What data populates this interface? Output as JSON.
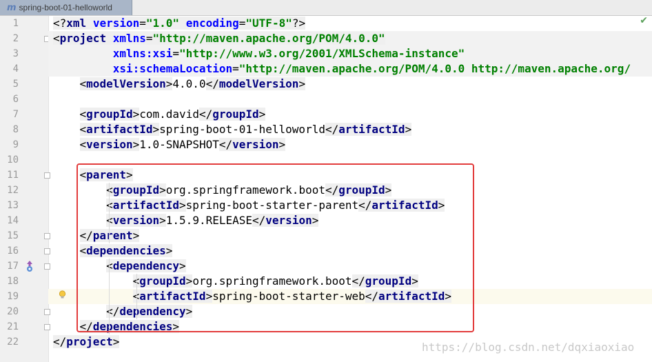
{
  "tab": {
    "icon": "maven-icon",
    "icon_glyph": "m",
    "label": "spring-boot-01-helloworld"
  },
  "status": {
    "check_icon": "checkmark-icon"
  },
  "watermark": "https://blog.csdn.net/dqxiaoxiao",
  "lines": [
    {
      "n": "1",
      "code": "<?xml version=\"1.0\" encoding=\"UTF-8\"?>"
    },
    {
      "n": "2",
      "code": "<project xmlns=\"http://maven.apache.org/POM/4.0.0\""
    },
    {
      "n": "3",
      "code": "         xmlns:xsi=\"http://www.w3.org/2001/XMLSchema-instance\""
    },
    {
      "n": "4",
      "code": "         xsi:schemaLocation=\"http://maven.apache.org/POM/4.0.0 http://maven.apache.org/"
    },
    {
      "n": "5",
      "code": "    <modelVersion>4.0.0</modelVersion>"
    },
    {
      "n": "6",
      "code": ""
    },
    {
      "n": "7",
      "code": "    <groupId>com.david</groupId>"
    },
    {
      "n": "8",
      "code": "    <artifactId>spring-boot-01-helloworld</artifactId>"
    },
    {
      "n": "9",
      "code": "    <version>1.0-SNAPSHOT</version>"
    },
    {
      "n": "10",
      "code": ""
    },
    {
      "n": "11",
      "code": "    <parent>"
    },
    {
      "n": "12",
      "code": "        <groupId>org.springframework.boot</groupId>"
    },
    {
      "n": "13",
      "code": "        <artifactId>spring-boot-starter-parent</artifactId>"
    },
    {
      "n": "14",
      "code": "        <version>1.5.9.RELEASE</version>"
    },
    {
      "n": "15",
      "code": "    </parent>"
    },
    {
      "n": "16",
      "code": "    <dependencies>"
    },
    {
      "n": "17",
      "code": "        <dependency>"
    },
    {
      "n": "18",
      "code": "            <groupId>org.springframework.boot</groupId>"
    },
    {
      "n": "19",
      "code": "            <artifactId>spring-boot-starter-web</artifactId>"
    },
    {
      "n": "20",
      "code": "        </dependency>"
    },
    {
      "n": "21",
      "code": "    </dependencies>"
    },
    {
      "n": "22",
      "code": "</project>"
    }
  ]
}
